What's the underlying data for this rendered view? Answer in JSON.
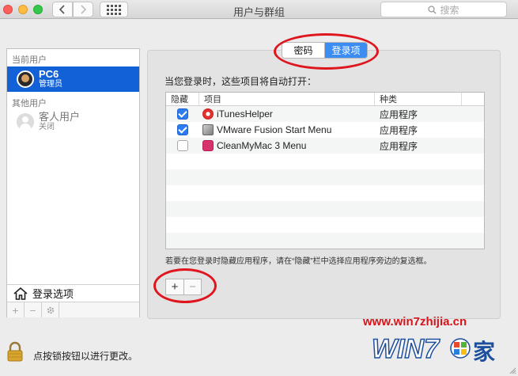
{
  "window": {
    "title": "用户与群组"
  },
  "search": {
    "placeholder": "搜索"
  },
  "sidebar": {
    "current_users_header": "当前用户",
    "current_user": {
      "name": "PC6",
      "role": "管理员"
    },
    "other_users_header": "其他用户",
    "guest_user": {
      "name": "客人用户",
      "status": "关闭"
    },
    "login_options_label": "登录选项",
    "buttons": {
      "add": "+",
      "remove": "−"
    }
  },
  "tabs": [
    {
      "label": "密码",
      "active": false
    },
    {
      "label": "登录项",
      "active": true
    }
  ],
  "login_items": {
    "intro": "当您登录时，这些项目将自动打开：",
    "columns": {
      "hide": "隐藏",
      "item": "项目",
      "kind": "种类"
    },
    "rows": [
      {
        "hidden": true,
        "name": "iTunesHelper",
        "kind": "应用程序",
        "icon": "itunes-icon"
      },
      {
        "hidden": true,
        "name": "VMware Fusion Start Menu",
        "kind": "应用程序",
        "icon": "vmware-icon"
      },
      {
        "hidden": false,
        "name": "CleanMyMac 3 Menu",
        "kind": "应用程序",
        "icon": "cleanmymac-icon"
      }
    ],
    "hint": "若要在您登录时隐藏应用程序，请在“隐藏”栏中选择应用程序旁边的复选框。",
    "add_label": "+",
    "remove_label": "−"
  },
  "lock": {
    "text": "点按锁按钮以进行更改。"
  },
  "watermark": {
    "url": "www.win7zhijia.cn",
    "logo_text": "WIN7",
    "logo_suffix": "家"
  },
  "colors": {
    "accent": "#3b8df4",
    "selection": "#1361d6",
    "annotation": "#e0161f"
  }
}
